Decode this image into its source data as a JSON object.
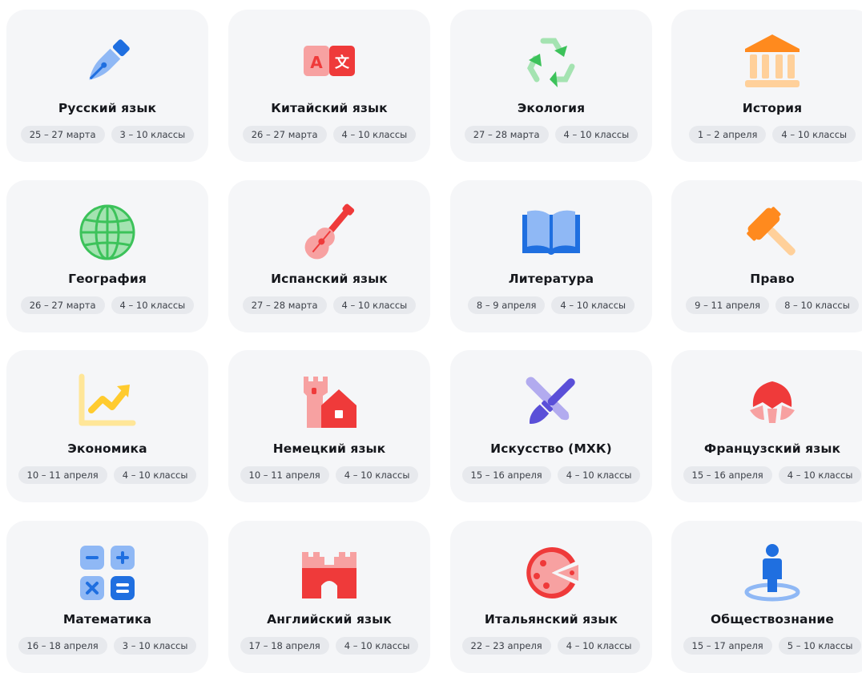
{
  "subjects": [
    {
      "title": "Русский язык",
      "dates": "25 – 27 марта",
      "grades": "3 – 10 классы",
      "icon": "fountain-pen-icon"
    },
    {
      "title": "Китайский язык",
      "dates": "26 – 27 марта",
      "grades": "4 – 10 классы",
      "icon": "translate-icon"
    },
    {
      "title": "Экология",
      "dates": "27 – 28 марта",
      "grades": "4 – 10 классы",
      "icon": "recycle-icon"
    },
    {
      "title": "История",
      "dates": "1 – 2 апреля",
      "grades": "4 – 10 классы",
      "icon": "museum-icon"
    },
    {
      "title": "География",
      "dates": "26 – 27 марта",
      "grades": "4 – 10 классы",
      "icon": "globe-icon"
    },
    {
      "title": "Испанский язык",
      "dates": "27 – 28 марта",
      "grades": "4 – 10 классы",
      "icon": "guitar-icon"
    },
    {
      "title": "Литература",
      "dates": "8 – 9 апреля",
      "grades": "4 – 10 классы",
      "icon": "open-book-icon"
    },
    {
      "title": "Право",
      "dates": "9 – 11 апреля",
      "grades": "8 – 10 классы",
      "icon": "gavel-icon"
    },
    {
      "title": "Экономика",
      "dates": "10 – 11 апреля",
      "grades": "4 – 10 классы",
      "icon": "trend-chart-icon"
    },
    {
      "title": "Немецкий язык",
      "dates": "10 – 11 апреля",
      "grades": "4 – 10 классы",
      "icon": "castle-house-icon"
    },
    {
      "title": "Искусство (МХК)",
      "dates": "15 – 16 апреля",
      "grades": "4 – 10 классы",
      "icon": "paintbrush-icon"
    },
    {
      "title": "Французский язык",
      "dates": "15 – 16 апреля",
      "grades": "4 – 10 классы",
      "icon": "croissant-icon"
    },
    {
      "title": "Математика",
      "dates": "16 – 18 апреля",
      "grades": "3 – 10 классы",
      "icon": "calculator-icon"
    },
    {
      "title": "Английский язык",
      "dates": "17 – 18 апреля",
      "grades": "4 – 10 классы",
      "icon": "castle-icon"
    },
    {
      "title": "Итальянский язык",
      "dates": "22 – 23 апреля",
      "grades": "4 – 10 классы",
      "icon": "pizza-icon"
    },
    {
      "title": "Обществознание",
      "dates": "15 – 17 апреля",
      "grades": "5 – 10 классы",
      "icon": "person-pin-icon"
    }
  ],
  "colors": {
    "card_background": "#f5f6f8",
    "chip_background": "#e7e9ed",
    "blue": "#1f6fe0",
    "light_blue": "#8fb8f5",
    "red": "#ef3a3a",
    "pink": "#f7a1a1",
    "green": "#3cc25a",
    "light_green": "#a4e3b1",
    "orange": "#ff8a1e",
    "peach": "#ffd09a",
    "yellow": "#ffcb2e",
    "light_yellow": "#ffe698",
    "purple": "#5a4fd8",
    "lavender": "#b2abef"
  }
}
